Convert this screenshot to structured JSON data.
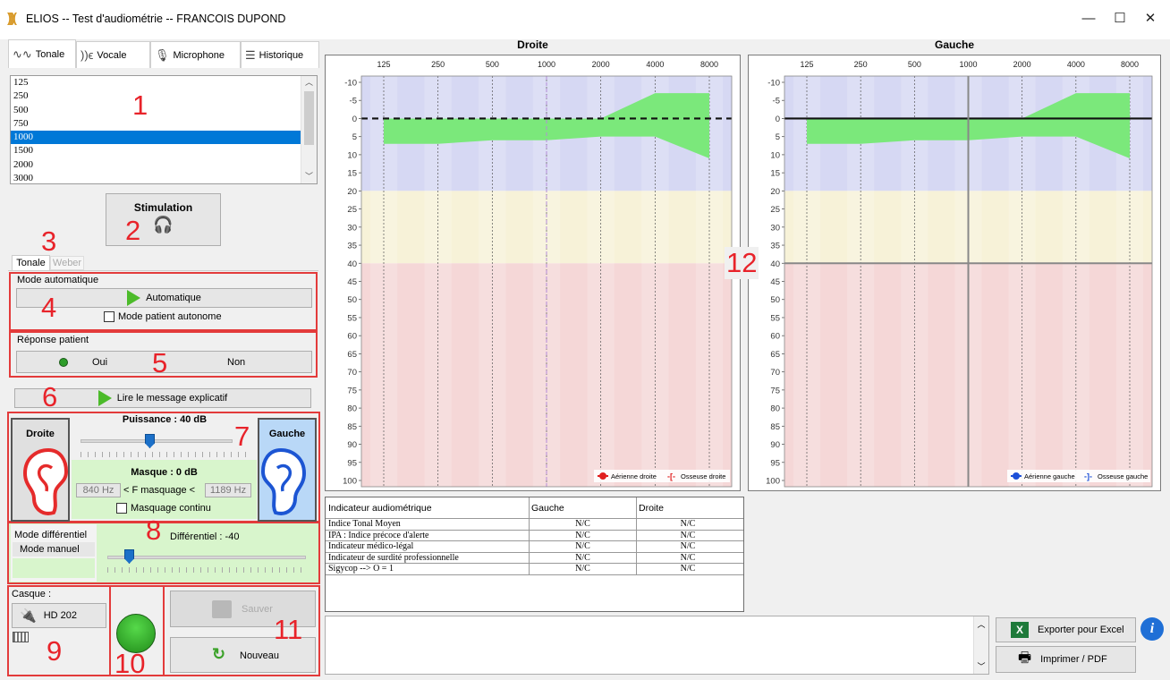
{
  "window": {
    "title": "ELIOS -- Test d'audiométrie -- FRANCOIS DUPOND",
    "minimize": "—",
    "maximize": "☐",
    "close": "✕"
  },
  "tabs": [
    {
      "label": "Tonale",
      "icon": "waveform-icon"
    },
    {
      "label": "Vocale",
      "icon": "speech-icon"
    },
    {
      "label": "Microphone",
      "icon": "microphone-icon"
    },
    {
      "label": "Historique",
      "icon": "list-icon"
    }
  ],
  "frequency_list": {
    "items": [
      "125",
      "250",
      "500",
      "750",
      "1000",
      "1500",
      "2000",
      "3000"
    ],
    "selected": "1000"
  },
  "callouts": [
    "1",
    "2",
    "3",
    "4",
    "5",
    "6",
    "7",
    "8",
    "9",
    "10",
    "11",
    "12"
  ],
  "stimulation": {
    "label": "Stimulation",
    "icon": "headphones-icon"
  },
  "subtabs": {
    "tonale": "Tonale",
    "weber": "Weber"
  },
  "mode_auto": {
    "group": "Mode automatique",
    "button": "Automatique",
    "checkbox": "Mode patient autonome"
  },
  "reponse": {
    "group": "Réponse patient",
    "oui": "Oui",
    "non": "Non"
  },
  "message_button": "Lire le message explicatif",
  "puissance": {
    "droite": "Droite",
    "gauche": "Gauche",
    "label": "Puissance : 40 dB"
  },
  "masque": {
    "label": "Masque : 0 dB",
    "low": "840 Hz",
    "mid": "< F masquage <",
    "high": "1189 Hz",
    "checkbox": "Masquage continu"
  },
  "differentiel": {
    "group": "Mode différentiel",
    "mode": "Mode manuel",
    "label": "Différentiel : -40"
  },
  "casque": {
    "label": "Casque :",
    "model": "HD 202"
  },
  "actions": {
    "sauver": "Sauver",
    "nouveau": "Nouveau"
  },
  "chart_data": [
    {
      "type": "line",
      "title": "Droite",
      "x_ticks": [
        "125",
        "250",
        "500",
        "1000",
        "2000",
        "4000",
        "8000"
      ],
      "y_ticks": [
        -10,
        -5,
        0,
        5,
        10,
        15,
        20,
        25,
        30,
        35,
        40,
        45,
        50,
        55,
        60,
        65,
        70,
        75,
        80,
        85,
        90,
        95,
        100
      ],
      "ylim": [
        -10,
        100
      ],
      "y_inverted": true,
      "zones": [
        {
          "from": -10,
          "to": 20,
          "color": "#d6d8f3"
        },
        {
          "from": 20,
          "to": 40,
          "color": "#f7f2d8"
        },
        {
          "from": 40,
          "to": 100,
          "color": "#f5d7d7"
        }
      ],
      "normal_band": {
        "x": [
          "125",
          "250",
          "500",
          "1000",
          "2000",
          "4000",
          "8000"
        ],
        "upper": [
          0,
          0,
          0,
          0,
          0,
          -7,
          -7
        ],
        "lower": [
          7,
          7,
          6,
          6,
          5,
          5,
          11
        ],
        "color": "#7be87b"
      },
      "reference_line": {
        "y": 0,
        "style": "dashed"
      },
      "legend": [
        {
          "label": "Aérienne droite",
          "color": "#e02020"
        },
        {
          "label": "Osseuse droite",
          "color": "#e02020"
        }
      ],
      "legend_position": "bottom-right"
    },
    {
      "type": "line",
      "title": "Gauche",
      "x_ticks": [
        "125",
        "250",
        "500",
        "1000",
        "2000",
        "4000",
        "8000"
      ],
      "y_ticks": [
        -10,
        -5,
        0,
        5,
        10,
        15,
        20,
        25,
        30,
        35,
        40,
        45,
        50,
        55,
        60,
        65,
        70,
        75,
        80,
        85,
        90,
        95,
        100
      ],
      "ylim": [
        -10,
        100
      ],
      "y_inverted": true,
      "zones": [
        {
          "from": -10,
          "to": 20,
          "color": "#d6d8f3"
        },
        {
          "from": 20,
          "to": 40,
          "color": "#f7f2d8"
        },
        {
          "from": 40,
          "to": 100,
          "color": "#f5d7d7"
        }
      ],
      "normal_band": {
        "x": [
          "125",
          "250",
          "500",
          "1000",
          "2000",
          "4000",
          "8000"
        ],
        "upper": [
          0,
          0,
          0,
          0,
          0,
          -7,
          -7
        ],
        "lower": [
          7,
          7,
          6,
          6,
          5,
          5,
          11
        ],
        "color": "#7be87b"
      },
      "reference_line": {
        "y": 0,
        "style": "solid"
      },
      "crosshair": {
        "x": "1000",
        "y": 40
      },
      "legend": [
        {
          "label": "Aérienne gauche",
          "color": "#1c4fd8"
        },
        {
          "label": "Osseuse gauche",
          "color": "#1c4fd8"
        }
      ],
      "legend_position": "bottom-right"
    }
  ],
  "indicators": {
    "headers": [
      "Indicateur audiométrique",
      "Gauche",
      "Droite"
    ],
    "rows": [
      [
        "Indice Tonal Moyen",
        "N/C",
        "N/C"
      ],
      [
        "IPA : Indice précoce d'alerte",
        "N/C",
        "N/C"
      ],
      [
        "Indicateur médico-légal",
        "N/C",
        "N/C"
      ],
      [
        "Indicateur de surdité professionnelle",
        "N/C",
        "N/C"
      ],
      [
        "Sigycop --> O = 1",
        "N/C",
        "N/C"
      ]
    ]
  },
  "export": {
    "excel": "Exporter pour Excel",
    "print": "Imprimer / PDF"
  }
}
